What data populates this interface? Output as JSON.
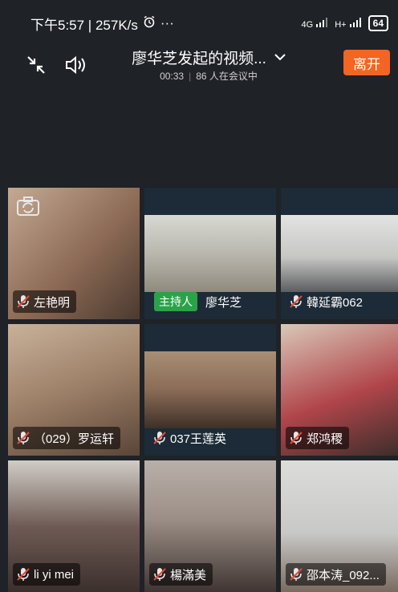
{
  "status_bar": {
    "time_speed": "下午5:57 | 257K/s",
    "more": "···",
    "net_4g": "4G",
    "net_hplus": "H+",
    "battery": "64"
  },
  "header": {
    "title": "廖华芝发起的视频...",
    "duration": "00:33",
    "participants": "86 人在会议中",
    "leave_label": "离开"
  },
  "tiles": [
    {
      "name": "左艳明",
      "muted": true,
      "video": "#8c6a55"
    },
    {
      "name": "廖华芝",
      "host_badge": "主持人",
      "muted": false,
      "video": "#b9b7ae"
    },
    {
      "name": "韓延霸062",
      "muted": true,
      "video": "#c6c6c3"
    },
    {
      "name": "（029）罗运轩",
      "muted": true,
      "video": "#9c7f67"
    },
    {
      "name": "037王莲英",
      "muted": true,
      "video": "#8b6c56"
    },
    {
      "name": "郑鸿稷",
      "muted": true,
      "video": "#b0454a"
    },
    {
      "name": "li yi mei",
      "muted": true,
      "video": "#6f5b55"
    },
    {
      "name": "楊滿美",
      "muted": true,
      "video": "#9b8e86"
    },
    {
      "name": "邵本涛_092...",
      "muted": true,
      "video": "#c8c9c7"
    }
  ]
}
